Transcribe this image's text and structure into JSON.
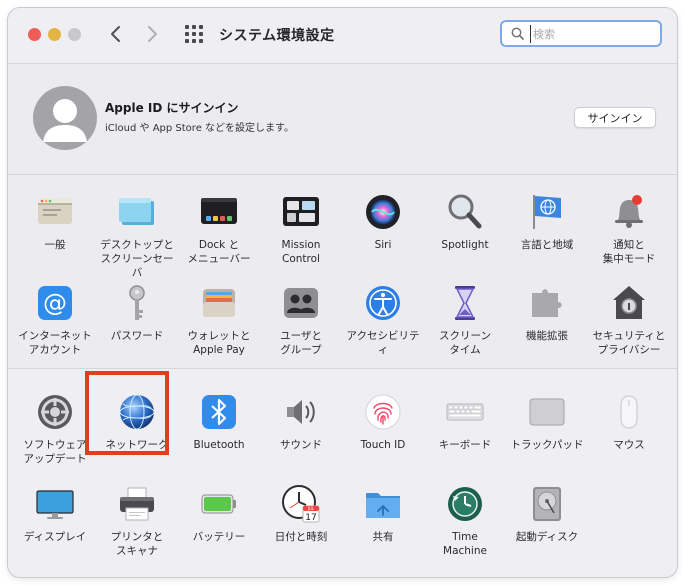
{
  "window": {
    "title": "システム環境設定"
  },
  "nav": {
    "back": "‹",
    "forward": "›"
  },
  "search": {
    "placeholder": "検索"
  },
  "account": {
    "title": "Apple ID にサインイン",
    "subtitle": "iCloud や App Store などを設定します。",
    "button": "サインイン"
  },
  "row1": [
    {
      "label": "一般",
      "icon": "general-icon"
    },
    {
      "label": "デスクトップと\nスクリーンセーバ",
      "icon": "desktop-icon"
    },
    {
      "label": "Dock と\nメニューバー",
      "icon": "dock-icon"
    },
    {
      "label": "Mission\nControl",
      "icon": "mission-control-icon"
    },
    {
      "label": "Siri",
      "icon": "siri-icon"
    },
    {
      "label": "Spotlight",
      "icon": "spotlight-icon"
    },
    {
      "label": "言語と地域",
      "icon": "language-icon"
    },
    {
      "label": "通知と\n集中モード",
      "icon": "notifications-icon"
    }
  ],
  "row2": [
    {
      "label": "インターネット\nアカウント",
      "icon": "internet-accounts-icon"
    },
    {
      "label": "パスワード",
      "icon": "passwords-icon"
    },
    {
      "label": "ウォレットと\nApple Pay",
      "icon": "wallet-icon"
    },
    {
      "label": "ユーザと\nグループ",
      "icon": "users-icon"
    },
    {
      "label": "アクセシビリティ",
      "icon": "accessibility-icon"
    },
    {
      "label": "スクリーン\nタイム",
      "icon": "screen-time-icon"
    },
    {
      "label": "機能拡張",
      "icon": "extensions-icon"
    },
    {
      "label": "セキュリティと\nプライバシー",
      "icon": "security-icon"
    }
  ],
  "row3": [
    {
      "label": "ソフトウェア\nアップデート",
      "icon": "software-update-icon"
    },
    {
      "label": "ネットワーク",
      "icon": "network-icon"
    },
    {
      "label": "Bluetooth",
      "icon": "bluetooth-icon"
    },
    {
      "label": "サウンド",
      "icon": "sound-icon"
    },
    {
      "label": "Touch ID",
      "icon": "touch-id-icon"
    },
    {
      "label": "キーボード",
      "icon": "keyboard-icon"
    },
    {
      "label": "トラックパッド",
      "icon": "trackpad-icon"
    },
    {
      "label": "マウス",
      "icon": "mouse-icon"
    }
  ],
  "row4": [
    {
      "label": "ディスプレイ",
      "icon": "display-icon"
    },
    {
      "label": "プリンタと\nスキャナ",
      "icon": "printer-icon"
    },
    {
      "label": "バッテリー",
      "icon": "battery-icon"
    },
    {
      "label": "日付と時刻",
      "icon": "date-time-icon",
      "calendar_month": "JUL",
      "calendar_day": "17"
    },
    {
      "label": "共有",
      "icon": "sharing-icon"
    },
    {
      "label": "Time\nMachine",
      "icon": "time-machine-icon"
    },
    {
      "label": "起動ディスク",
      "icon": "startup-disk-icon"
    }
  ]
}
